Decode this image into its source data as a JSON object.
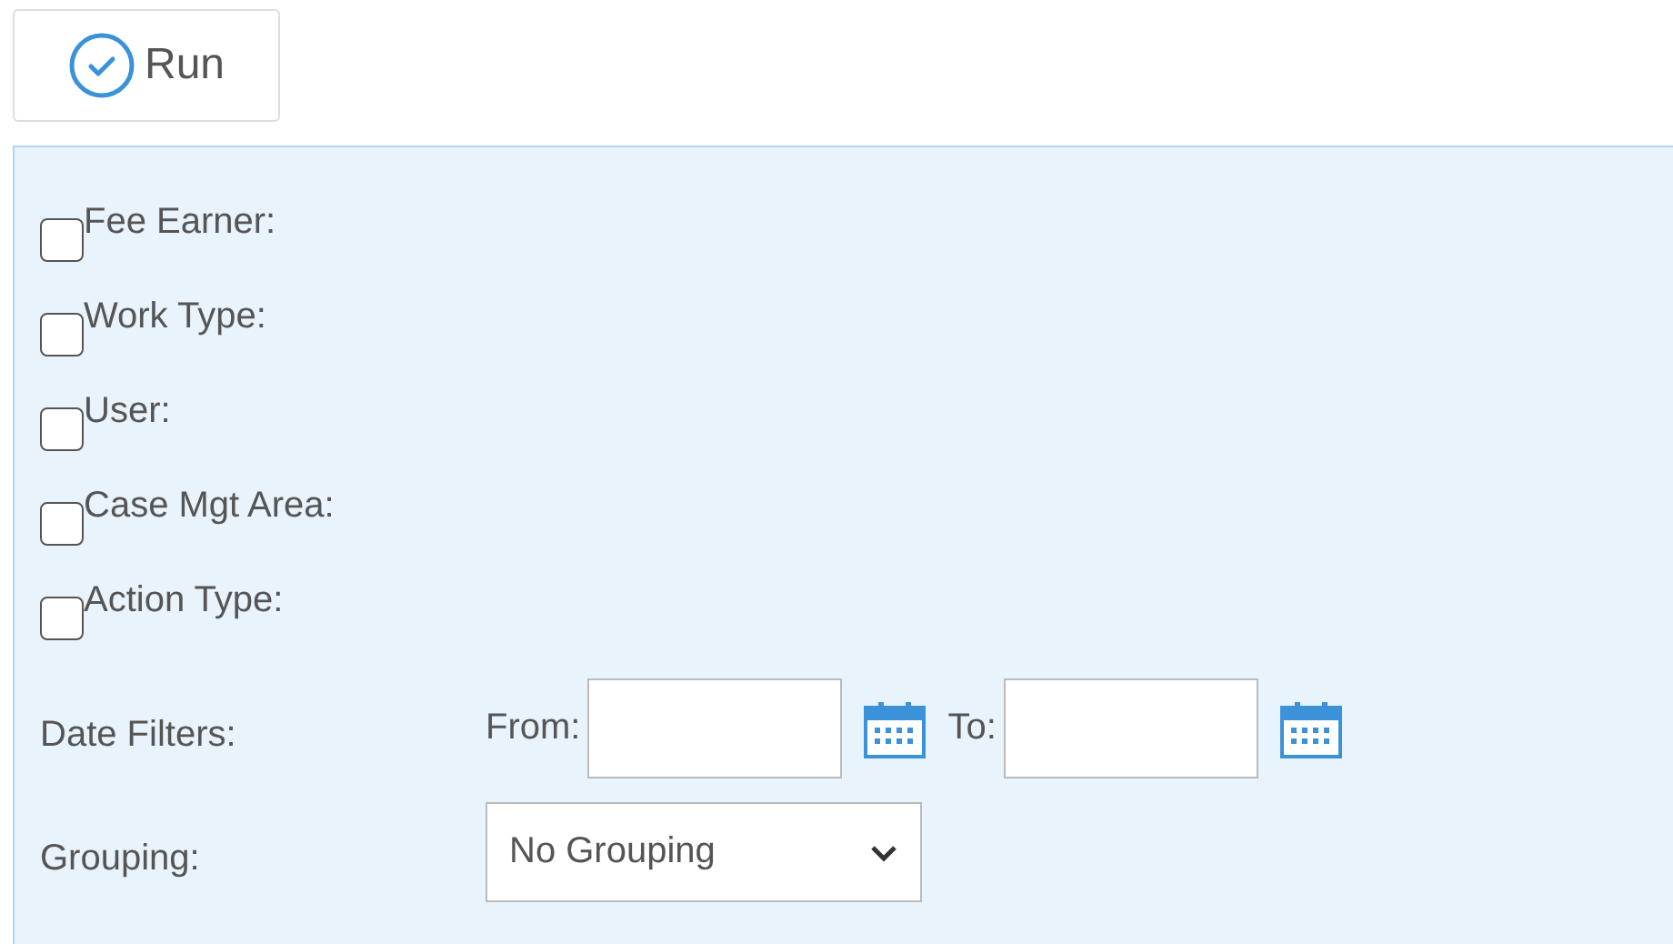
{
  "toolbar": {
    "run_button": {
      "label": "Run"
    }
  },
  "filters": [
    {
      "label": "Fee Earner:",
      "checked": false
    },
    {
      "label": "Work Type:",
      "checked": false
    },
    {
      "label": "User:",
      "checked": false
    },
    {
      "label": "Case Mgt Area:",
      "checked": false
    },
    {
      "label": "Action Type:",
      "checked": false
    }
  ],
  "date_filters": {
    "label": "Date Filters:",
    "from_label": "From:",
    "to_label": "To:"
  },
  "grouping": {
    "label": "Grouping:",
    "value": "No Grouping"
  }
}
